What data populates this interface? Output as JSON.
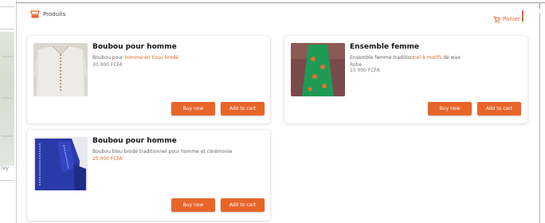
{
  "colors": {
    "accent": "#e8652a",
    "page": "#ffffff",
    "card": "#ffffff"
  },
  "header": {
    "brand_label": "Produits",
    "cart_label": "Panier"
  },
  "left_panel": {
    "fragment": "ivy"
  },
  "products": [
    {
      "title": "Boubou pour homme",
      "description_start": "Boubou pour ",
      "description_accent": "homme en tissu brodé",
      "subline": "",
      "price": "30 000 FCFA",
      "buy_label": "Buy now",
      "add_label": "Add to cart"
    },
    {
      "title": "Ensemble femme",
      "description_start": "Ensemble femme tradition",
      "description_accent": "nel à motifs",
      "description_end": " de wax",
      "subline": "Robe",
      "price": "15 000 FCFA",
      "buy_label": "Buy now",
      "add_label": "Add to cart"
    },
    {
      "title": "Boubou pour homme",
      "description_start": "Boubou bleu brodé traditionnel pour homme et cérémonie",
      "description_accent": "",
      "subline": "",
      "price": "25 000 FCFA",
      "buy_label": "Buy now",
      "add_label": "Add to cart"
    }
  ]
}
